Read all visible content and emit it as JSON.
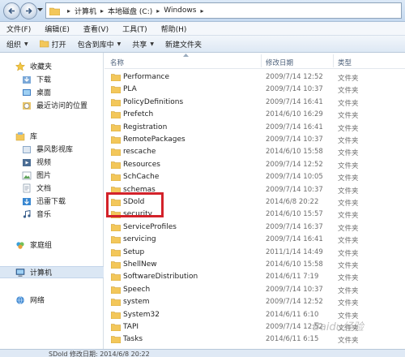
{
  "address": {
    "crumbs": [
      "计算机",
      "本地磁盘 (C:)",
      "Windows"
    ]
  },
  "menu": [
    "文件(F)",
    "编辑(E)",
    "查看(V)",
    "工具(T)",
    "帮助(H)"
  ],
  "toolbar": {
    "organize": "组织",
    "open": "打开",
    "include_in_library": "包含到库中",
    "share": "共享",
    "new_folder": "新建文件夹"
  },
  "nav": {
    "favorites": "收藏夹",
    "downloads": "下载",
    "desktop": "桌面",
    "recent": "最近访问的位置",
    "libraries": "库",
    "baofeng": "暴风影视库",
    "videos": "视频",
    "pictures": "图片",
    "documents": "文档",
    "xunlei": "迅雷下载",
    "music": "音乐",
    "homegroup": "家庭组",
    "computer": "计算机",
    "network": "网络"
  },
  "columns": {
    "name": "名称",
    "modified": "修改日期",
    "type": "类型"
  },
  "files": [
    {
      "name": "Performance",
      "date": "2009/7/14 12:52",
      "type": "文件夹"
    },
    {
      "name": "PLA",
      "date": "2009/7/14 10:37",
      "type": "文件夹"
    },
    {
      "name": "PolicyDefinitions",
      "date": "2009/7/14 16:41",
      "type": "文件夹"
    },
    {
      "name": "Prefetch",
      "date": "2014/6/10 16:29",
      "type": "文件夹"
    },
    {
      "name": "Registration",
      "date": "2009/7/14 16:41",
      "type": "文件夹"
    },
    {
      "name": "RemotePackages",
      "date": "2009/7/14 10:37",
      "type": "文件夹"
    },
    {
      "name": "rescache",
      "date": "2014/6/10 15:58",
      "type": "文件夹"
    },
    {
      "name": "Resources",
      "date": "2009/7/14 12:52",
      "type": "文件夹"
    },
    {
      "name": "SchCache",
      "date": "2009/7/14 10:05",
      "type": "文件夹"
    },
    {
      "name": "schemas",
      "date": "2009/7/14 10:37",
      "type": "文件夹"
    },
    {
      "name": "SDold",
      "date": "2014/6/8 20:22",
      "type": "文件夹"
    },
    {
      "name": "security",
      "date": "2014/6/10 15:57",
      "type": "文件夹"
    },
    {
      "name": "ServiceProfiles",
      "date": "2009/7/14 16:37",
      "type": "文件夹"
    },
    {
      "name": "servicing",
      "date": "2009/7/14 16:41",
      "type": "文件夹"
    },
    {
      "name": "Setup",
      "date": "2011/1/14 14:49",
      "type": "文件夹"
    },
    {
      "name": "ShellNew",
      "date": "2014/6/10 15:58",
      "type": "文件夹"
    },
    {
      "name": "SoftwareDistribution",
      "date": "2014/6/11 7:19",
      "type": "文件夹"
    },
    {
      "name": "Speech",
      "date": "2009/7/14 10:37",
      "type": "文件夹"
    },
    {
      "name": "system",
      "date": "2009/7/14 12:52",
      "type": "文件夹"
    },
    {
      "name": "System32",
      "date": "2014/6/11 6:10",
      "type": "文件夹"
    },
    {
      "name": "TAPI",
      "date": "2009/7/14 12:52",
      "type": "文件夹"
    },
    {
      "name": "Tasks",
      "date": "2014/6/11 6:15",
      "type": "文件夹"
    }
  ],
  "status": {
    "text": "SDold 修改日期: 2014/6/8 20:22"
  },
  "watermark": "Baidu经验",
  "colors": {
    "highlight_box": "#d3222a",
    "folder": "#f3c75a",
    "header_text": "#4c607a"
  }
}
